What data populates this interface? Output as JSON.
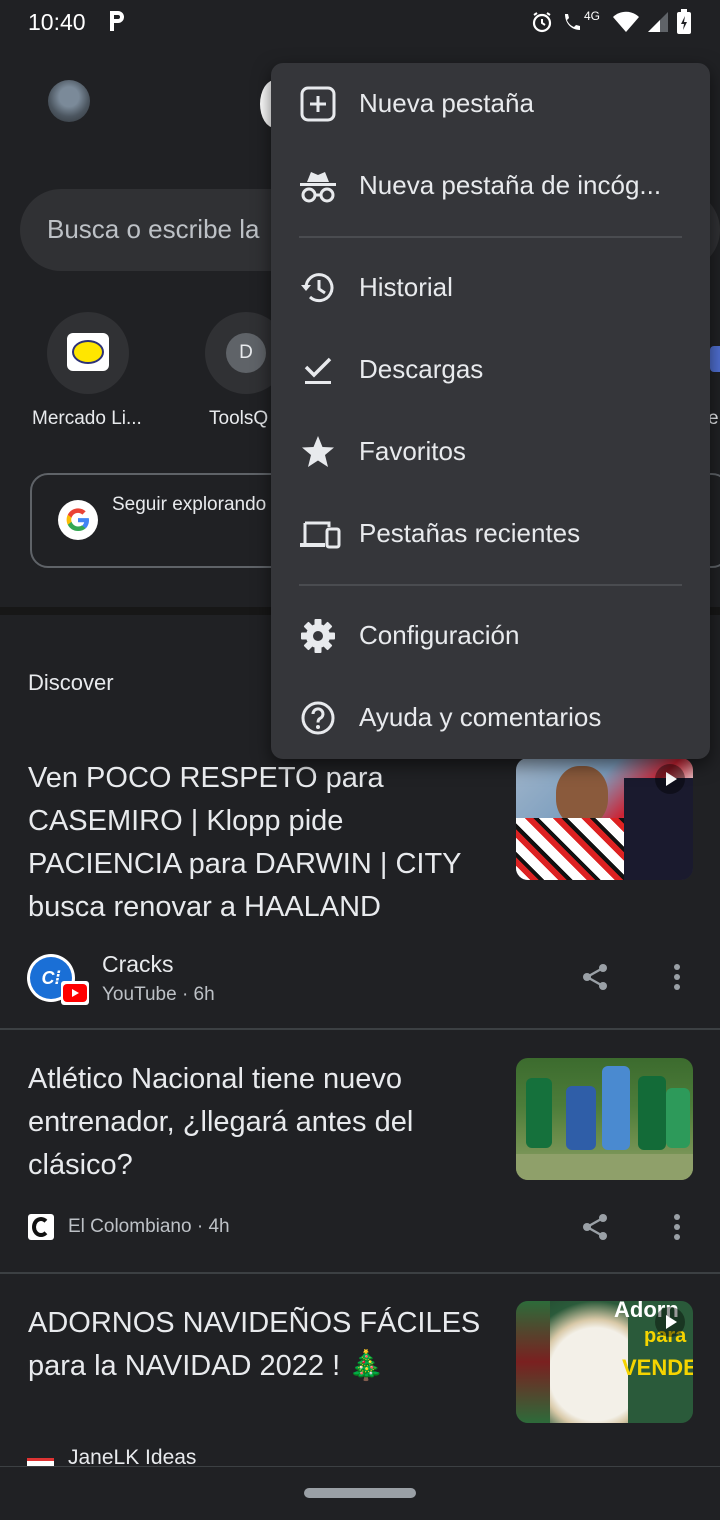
{
  "status_bar": {
    "time": "10:40",
    "network": "4G"
  },
  "ntp": {
    "search_placeholder": "Busca o escribe la",
    "shortcuts": [
      {
        "label": "Mercado Li...",
        "icon": "mercadolibre-icon"
      },
      {
        "label": "ToolsQ",
        "icon": "letter-d-icon",
        "letter": "D"
      },
      {
        "label": "e",
        "icon": "partial-shortcut-icon"
      }
    ],
    "explore_text": "Seguir explorando"
  },
  "discover": {
    "title": "Discover",
    "cards": [
      {
        "title": "Ven POCO RESPETO para CASEMIRO | Klopp pide PACIENCIA para DARWIN | CITY busca renovar a HAALAND",
        "source": "Cracks",
        "meta": "YouTube · 6h",
        "has_video": true
      },
      {
        "title": "Atlético Nacional tiene nuevo entrenador, ¿llegará antes del clásico?",
        "source": "El Colombiano · 4h"
      },
      {
        "title": "ADORNOS NAVIDEÑOS FÁCILES para la NAVIDAD 2022 ! 🎄",
        "source": "JaneLK Ideas",
        "thumb_text": [
          "Adorn",
          "para",
          "VENDE"
        ],
        "has_video": true
      }
    ]
  },
  "menu": {
    "items": [
      {
        "label": "Nueva pestaña",
        "icon": "new-tab-icon"
      },
      {
        "label": "Nueva pestaña de incóg...",
        "icon": "incognito-icon"
      },
      {
        "label": "Historial",
        "icon": "history-icon"
      },
      {
        "label": "Descargas",
        "icon": "downloads-icon"
      },
      {
        "label": "Favoritos",
        "icon": "star-icon"
      },
      {
        "label": "Pestañas recientes",
        "icon": "devices-icon"
      },
      {
        "label": "Configuración",
        "icon": "gear-icon"
      },
      {
        "label": "Ayuda y comentarios",
        "icon": "help-icon"
      }
    ]
  },
  "colors": {
    "background": "#202124",
    "menu_background": "#35363a",
    "text": "#e8eaed",
    "secondary_text": "#bdc1c6"
  }
}
